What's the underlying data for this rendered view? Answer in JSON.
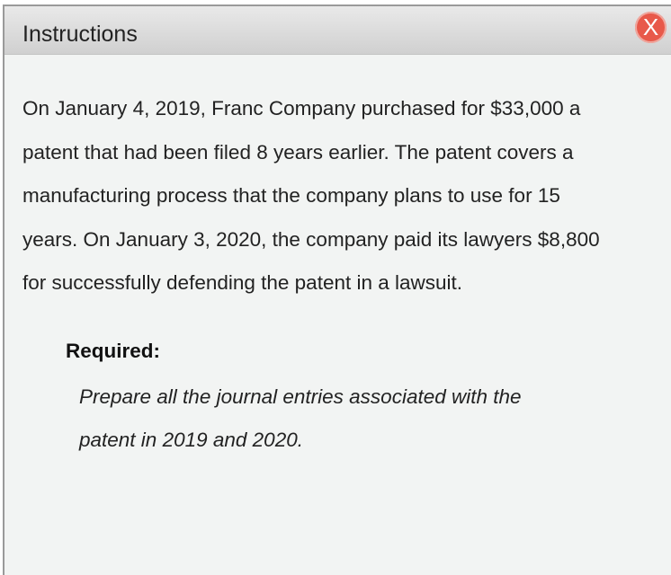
{
  "dialog": {
    "title": "Instructions",
    "close_label": "X",
    "close_color": "#e8594a"
  },
  "body": {
    "paragraph_lines": [
      "On January 4, 2019, Franc Company purchased for $33,000 a",
      "patent that had been filed 8 years earlier. The patent covers a",
      "manufacturing process that the company plans to use for 15",
      "years. On January 3, 2020, the company paid its lawyers $8,800",
      "for successfully defending the patent in a lawsuit."
    ],
    "required_label": "Required:",
    "required_lines": [
      "Prepare all the journal entries associated with the",
      "patent in 2019 and 2020."
    ]
  }
}
